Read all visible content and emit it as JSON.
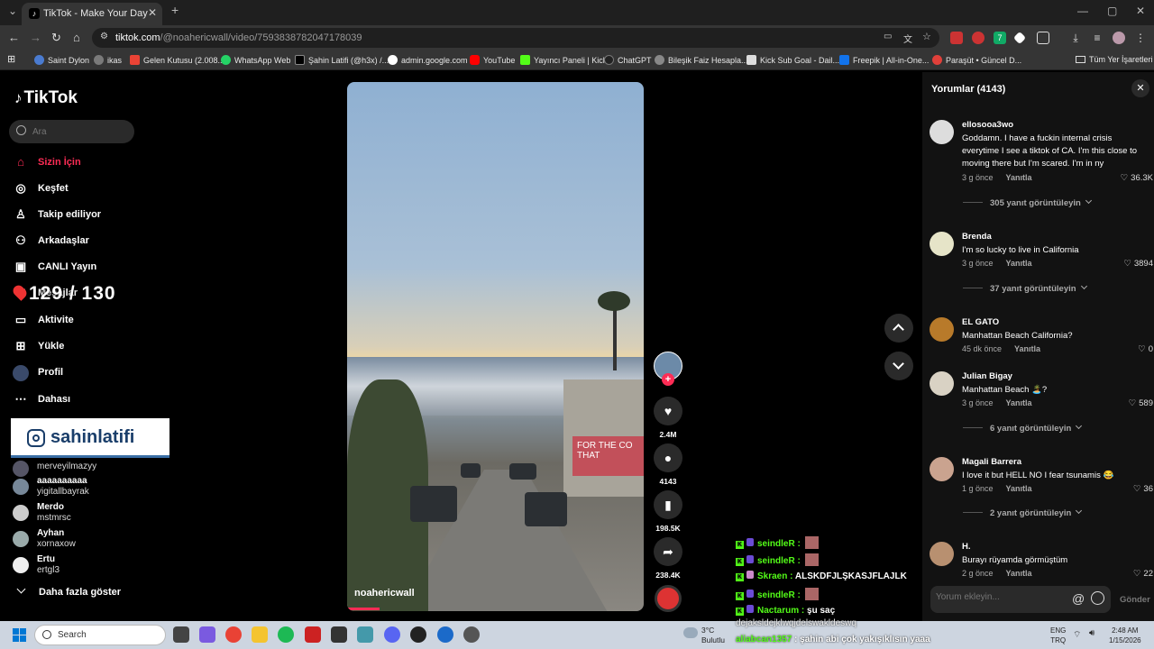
{
  "browser": {
    "tab_title": "TikTok - Make Your Day",
    "url_host": "tiktok.com",
    "url_path": "/@noahericwall/video/7593838782047178039",
    "bookmarks": [
      {
        "label": "Saint Dylon",
        "color": "#4a7bd0"
      },
      {
        "label": "ikas",
        "color": "#7a7a7a"
      },
      {
        "label": "Gelen Kutusu (2.008...",
        "color": "#ea4335"
      },
      {
        "label": "WhatsApp Web",
        "color": "#25d366"
      },
      {
        "label": "Şahin Latifi (@h3x) /...",
        "color": "#000000"
      },
      {
        "label": "admin.google.com",
        "color": "#ffffff"
      },
      {
        "label": "YouTube",
        "color": "#ff0000"
      },
      {
        "label": "Yayıncı Paneli | Kick",
        "color": "#53fc18"
      },
      {
        "label": "ChatGPT",
        "color": "#222222"
      },
      {
        "label": "Bileşik Faiz Hesapla...",
        "color": "#888888"
      },
      {
        "label": "Kick Sub Goal - Dail...",
        "color": "#dddddd"
      },
      {
        "label": "Freepik | All-in-One...",
        "color": "#1273eb"
      },
      {
        "label": "Paraşüt • Güncel D...",
        "color": "#e0403a"
      }
    ],
    "all_bookmarks": "Tüm Yer İşaretleri"
  },
  "tiktok": {
    "logo": "TikTok",
    "search_placeholder": "Ara",
    "nav": [
      {
        "label": "Sizin İçin",
        "icon": "home-icon",
        "active": true
      },
      {
        "label": "Keşfet",
        "icon": "compass-icon"
      },
      {
        "label": "Takip ediliyor",
        "icon": "following-icon"
      },
      {
        "label": "Arkadaşlar",
        "icon": "friends-icon"
      },
      {
        "label": "CANLI Yayın",
        "icon": "live-icon"
      },
      {
        "label": "Mesajlar",
        "icon": "message-icon"
      },
      {
        "label": "Aktivite",
        "icon": "activity-icon"
      },
      {
        "label": "Yükle",
        "icon": "upload-icon"
      },
      {
        "label": "Profil",
        "icon": "profile-icon"
      },
      {
        "label": "Dahası",
        "icon": "more-icon"
      }
    ],
    "counter": "129 / 130",
    "instagram_handle": "sahinlatifi",
    "following": [
      {
        "name": "",
        "user": "merveyilmazyy"
      },
      {
        "name": "aaaaaaaaaa",
        "user": "yigitallbayrak"
      },
      {
        "name": "Merdo",
        "user": "mstmrsc"
      },
      {
        "name": "Ayhan",
        "user": "xornaxow"
      },
      {
        "name": "Ertu",
        "user": "ertgl3"
      }
    ],
    "show_more": "Daha fazla göster",
    "video": {
      "author": "noahericwall",
      "sign_text": "FOR THE CO THAT",
      "progress": 0.11
    },
    "actions": {
      "likes": "2.4M",
      "comments": "4143",
      "saves": "198.5K",
      "shares": "238.4K"
    }
  },
  "chat": [
    {
      "user": "seindleR :",
      "text": ""
    },
    {
      "user": "seindleR :",
      "text": ""
    },
    {
      "user": "Skraen :",
      "text": "ALSKDFJLŞKASJFLAJLK"
    },
    {
      "user": "seindleR :",
      "text": ""
    },
    {
      "user": "Nactarum :",
      "text": "şu saç"
    }
  ],
  "chat_overlap": "dejaksldejklwqjdelswakldeswq",
  "chat_overlap2_user": "aliabcan1357",
  "chat_overlap2_text": " : şahin abi çok yakışıklısın yaaa",
  "comments_panel": {
    "title": "Yorumlar",
    "count": "(4143)",
    "comments": [
      {
        "user": "ellosooa3wo",
        "text": "Goddamn. I have a fuckin internal crisis everytime I see a tiktok of CA. I'm this close to moving there but I'm scared. I'm in ny",
        "time": "3 g önce",
        "reply": "Yanıtla",
        "likes": "36.3K",
        "replies": "305 yanıt görüntüleyin"
      },
      {
        "user": "Brenda",
        "text": "I'm so lucky to live in California",
        "time": "3 g önce",
        "reply": "Yanıtla",
        "likes": "3894",
        "replies": "37 yanıt görüntüleyin"
      },
      {
        "user": "EL GATO",
        "text": "Manhattan Beach California?",
        "time": "45 dk önce",
        "reply": "Yanıtla",
        "likes": "0",
        "replies": ""
      },
      {
        "user": "Julian Bigay",
        "text": "Manhattan Beach 🏝️?",
        "time": "3 g önce",
        "reply": "Yanıtla",
        "likes": "589",
        "replies": "6 yanıt görüntüleyin"
      },
      {
        "user": "Magali Barrera",
        "text": "I love it but HELL NO I fear tsunamis 😂",
        "time": "1 g önce",
        "reply": "Yanıtla",
        "likes": "36",
        "replies": "2 yanıt görüntüleyin"
      },
      {
        "user": "H.",
        "text": "Burayı rüyamda görmüştüm",
        "time": "2 g önce",
        "reply": "Yanıtla",
        "likes": "22",
        "replies": ""
      }
    ],
    "input_placeholder": "Yorum ekleyin...",
    "send": "Gönder"
  },
  "taskbar": {
    "search": "Search",
    "weather_temp": "3°C",
    "weather_desc": "Bulutlu",
    "lang1": "ENG",
    "lang2": "TRQ",
    "time": "2:48 AM",
    "date": "1/15/2026"
  }
}
